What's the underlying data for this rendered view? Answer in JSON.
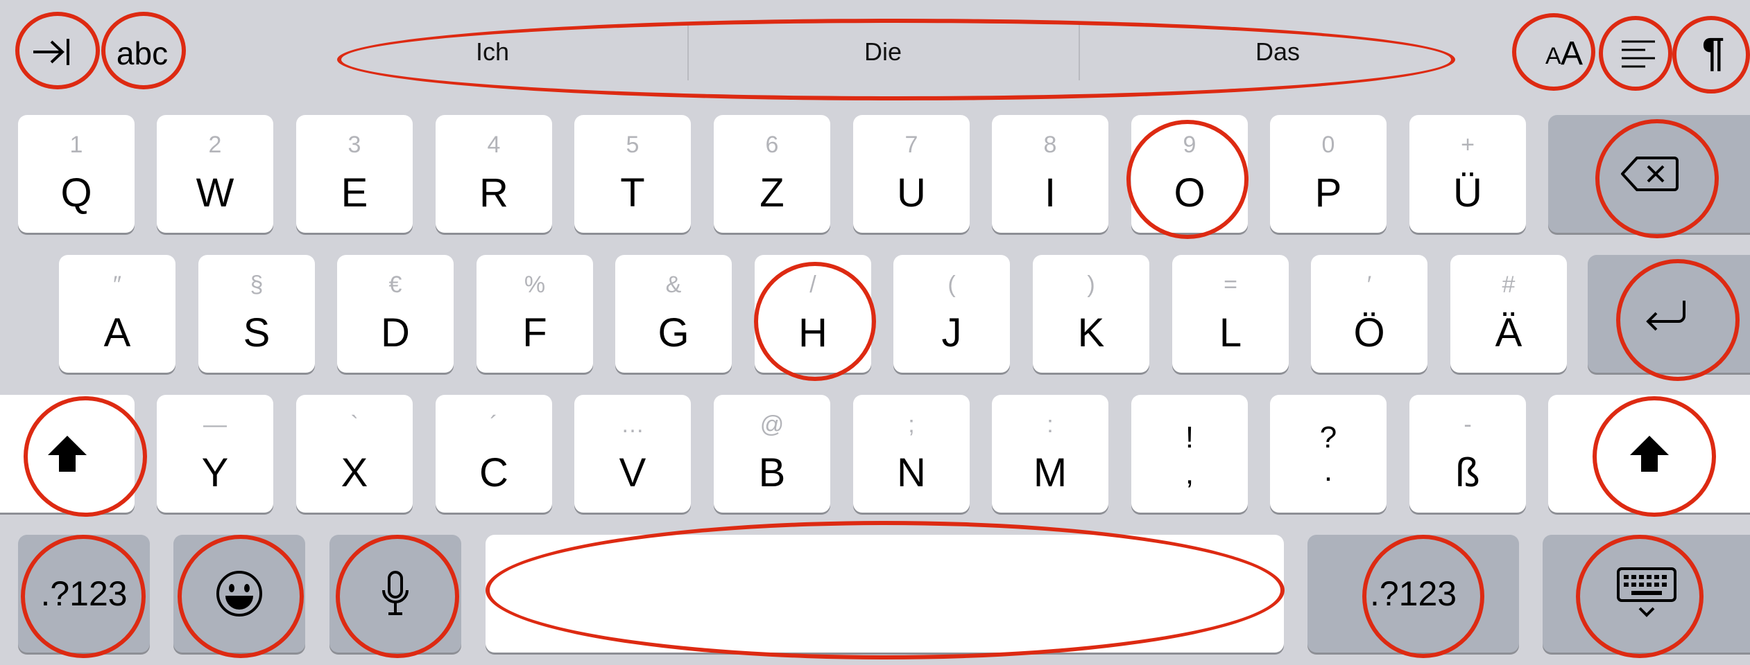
{
  "toolbar": {
    "tab_icon": "tab-right-arrow-icon",
    "abc_label": "abc",
    "suggestions": [
      "Ich",
      "Die",
      "Das"
    ],
    "font_size_label": "AA",
    "align_icon": "text-align-left-icon",
    "pilcrow_label": "¶"
  },
  "rows": {
    "row1": [
      {
        "sec": "1",
        "pri": "Q"
      },
      {
        "sec": "2",
        "pri": "W"
      },
      {
        "sec": "3",
        "pri": "E"
      },
      {
        "sec": "4",
        "pri": "R"
      },
      {
        "sec": "5",
        "pri": "T"
      },
      {
        "sec": "6",
        "pri": "Z"
      },
      {
        "sec": "7",
        "pri": "U"
      },
      {
        "sec": "8",
        "pri": "I"
      },
      {
        "sec": "9",
        "pri": "O"
      },
      {
        "sec": "0",
        "pri": "P"
      },
      {
        "sec": "+",
        "pri": "Ü"
      }
    ],
    "row2": [
      {
        "sec": "″",
        "pri": "A"
      },
      {
        "sec": "§",
        "pri": "S"
      },
      {
        "sec": "€",
        "pri": "D"
      },
      {
        "sec": "%",
        "pri": "F"
      },
      {
        "sec": "&",
        "pri": "G"
      },
      {
        "sec": "/",
        "pri": "H"
      },
      {
        "sec": "(",
        "pri": "J"
      },
      {
        "sec": ")",
        "pri": "K"
      },
      {
        "sec": "=",
        "pri": "L"
      },
      {
        "sec": "′",
        "pri": "Ö"
      },
      {
        "sec": "#",
        "pri": "Ä"
      }
    ],
    "row3": [
      {
        "sec": "—",
        "pri": "Y"
      },
      {
        "sec": "`",
        "pri": "X"
      },
      {
        "sec": "´",
        "pri": "C"
      },
      {
        "sec": "…",
        "pri": "V"
      },
      {
        "sec": "@",
        "pri": "B"
      },
      {
        "sec": ";",
        "pri": "N"
      },
      {
        "sec": ":",
        "pri": "M"
      }
    ],
    "row3_dual": [
      {
        "top": "!",
        "bottom": ","
      },
      {
        "top": "?",
        "bottom": "."
      }
    ],
    "row3_eszett": {
      "sec": "-",
      "pri": "ß"
    }
  },
  "bottom_row": {
    "numbers_left_label": ".?123",
    "emoji_icon": "emoji-face-icon",
    "mic_icon": "microphone-icon",
    "space_label": "",
    "numbers_right_label": ".?123",
    "dismiss_icon": "keyboard-dismiss-icon"
  },
  "special_keys": {
    "delete_icon": "backspace-icon",
    "return_icon": "return-arrow-icon",
    "shift_icon": "shift-arrow-icon"
  },
  "colors": {
    "background": "#d2d3d9",
    "key": "#ffffff",
    "special_key": "#adb2bc",
    "highlight_ring": "#dd2a12"
  }
}
